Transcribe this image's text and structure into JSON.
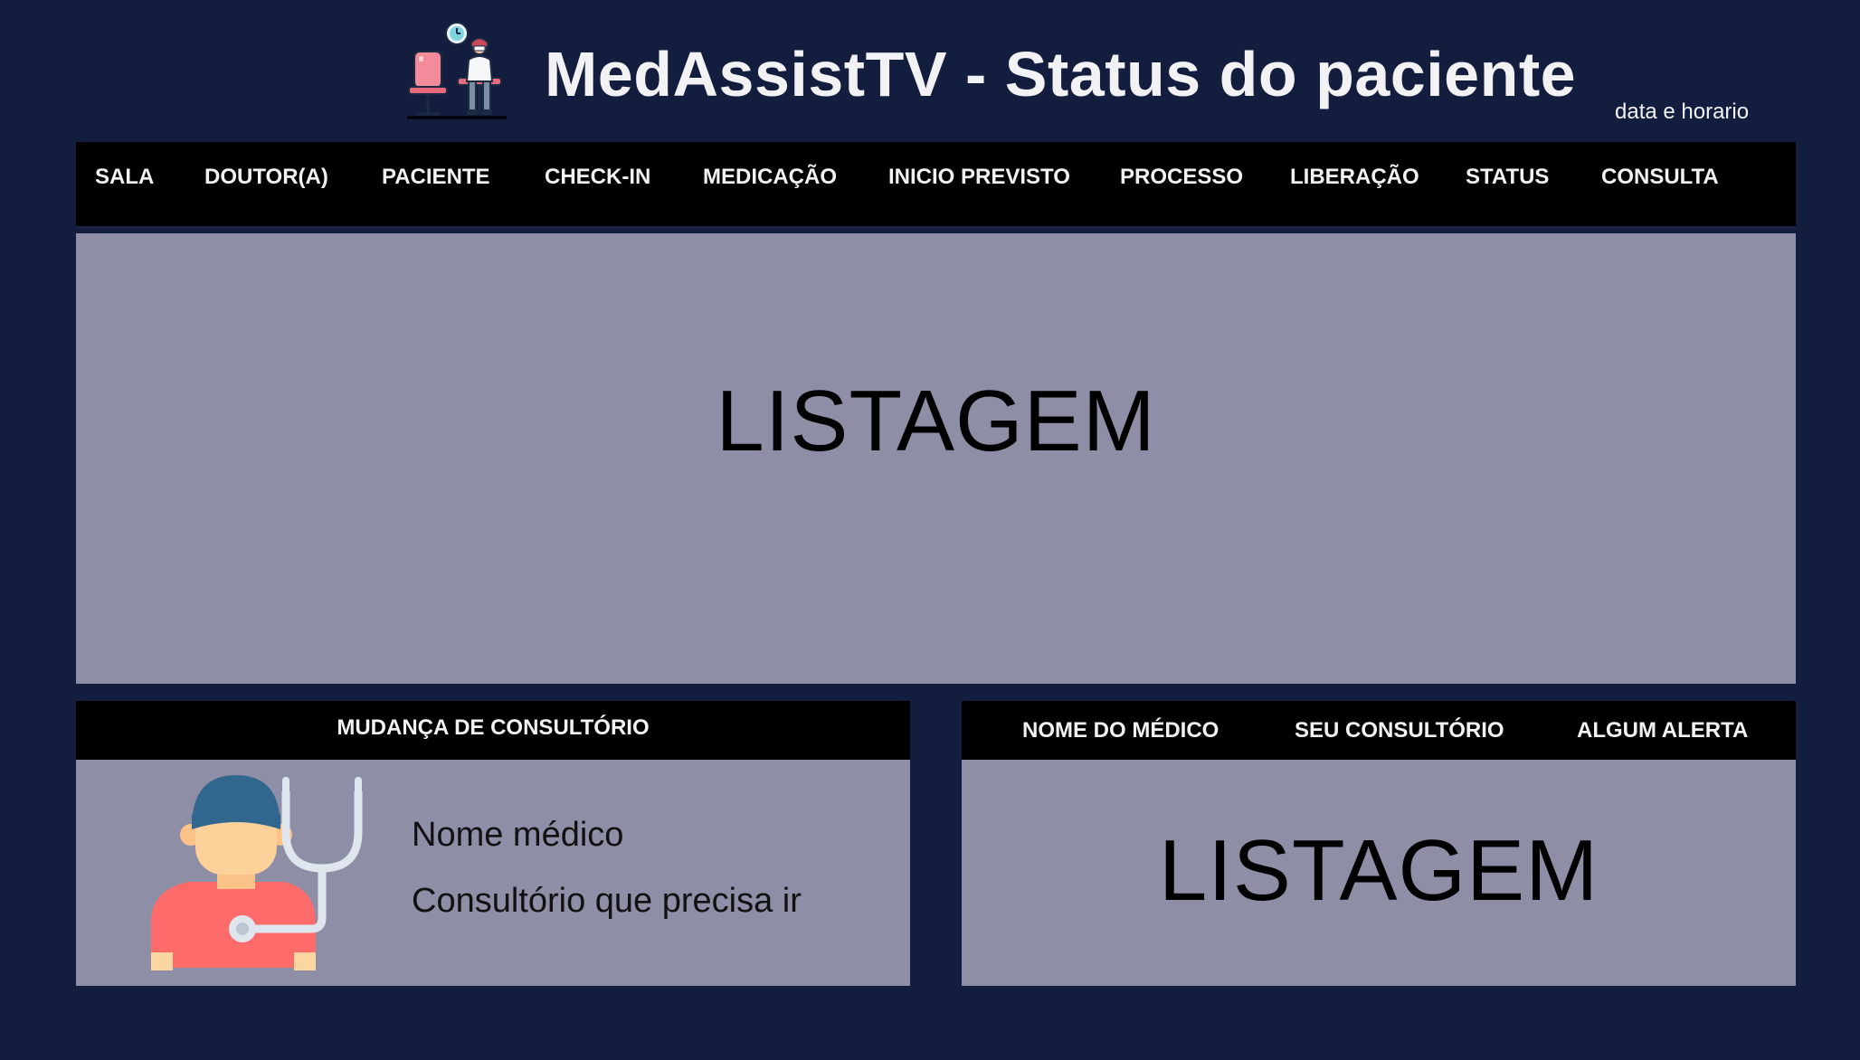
{
  "header": {
    "title": "MedAssistTV - Status do paciente",
    "datetime_label": "data e horario",
    "logo_icon": "waiting-room-icon"
  },
  "columns": [
    {
      "label": "SALA"
    },
    {
      "label": "DOUTOR(A)"
    },
    {
      "label": "PACIENTE"
    },
    {
      "label": "CHECK-IN"
    },
    {
      "label": "MEDICAÇÃO"
    },
    {
      "label": "INICIO PREVISTO"
    },
    {
      "label": "PROCESSO"
    },
    {
      "label": "LIBERAÇÃO"
    },
    {
      "label": "STATUS"
    },
    {
      "label": "CONSULTA"
    }
  ],
  "main_list": {
    "placeholder": "LISTAGEM"
  },
  "room_change": {
    "heading": "MUDANÇA DE CONSULTÓRIO",
    "doctor_name": "Nome médico",
    "room_instruction": "Consultório que precisa ir",
    "illustration_icon": "doctor-icon"
  },
  "doctor_panel": {
    "columns": [
      "NOME DO MÉDICO",
      "SEU CONSULTÓRIO",
      "ALGUM ALERTA"
    ],
    "placeholder": "LISTAGEM"
  },
  "colors": {
    "background": "#131d3d",
    "panel": "#8e8ea6",
    "header_bar": "#000000",
    "text_light": "#f2f2f5"
  }
}
